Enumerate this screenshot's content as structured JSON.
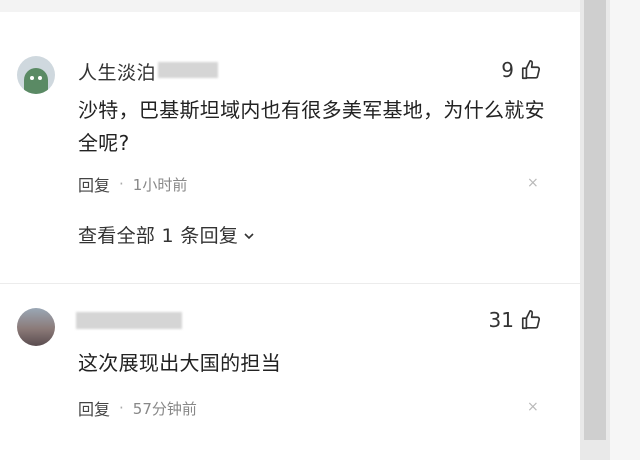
{
  "colors": {
    "text": "#222222",
    "meta": "#888888",
    "scrollbar": "#cfcfcf",
    "avatar_green": "#5a8a64"
  },
  "comments": [
    {
      "username": "人生淡泊",
      "likes": "9",
      "content": "沙特，巴基斯坦域内也有很多美军基地，为什么就安全呢?",
      "reply_label": "回复",
      "time": "1小时前",
      "close_icon": "×",
      "view_replies": "查看全部 1 条回复"
    },
    {
      "username": "",
      "likes": "31",
      "content": "这次展现出大国的担当",
      "reply_label": "回复",
      "time": "57分钟前",
      "close_icon": "×"
    }
  ],
  "icons": {
    "like": "thumbs-up-icon",
    "expand": "chevron-down-icon",
    "close": "close-icon"
  }
}
